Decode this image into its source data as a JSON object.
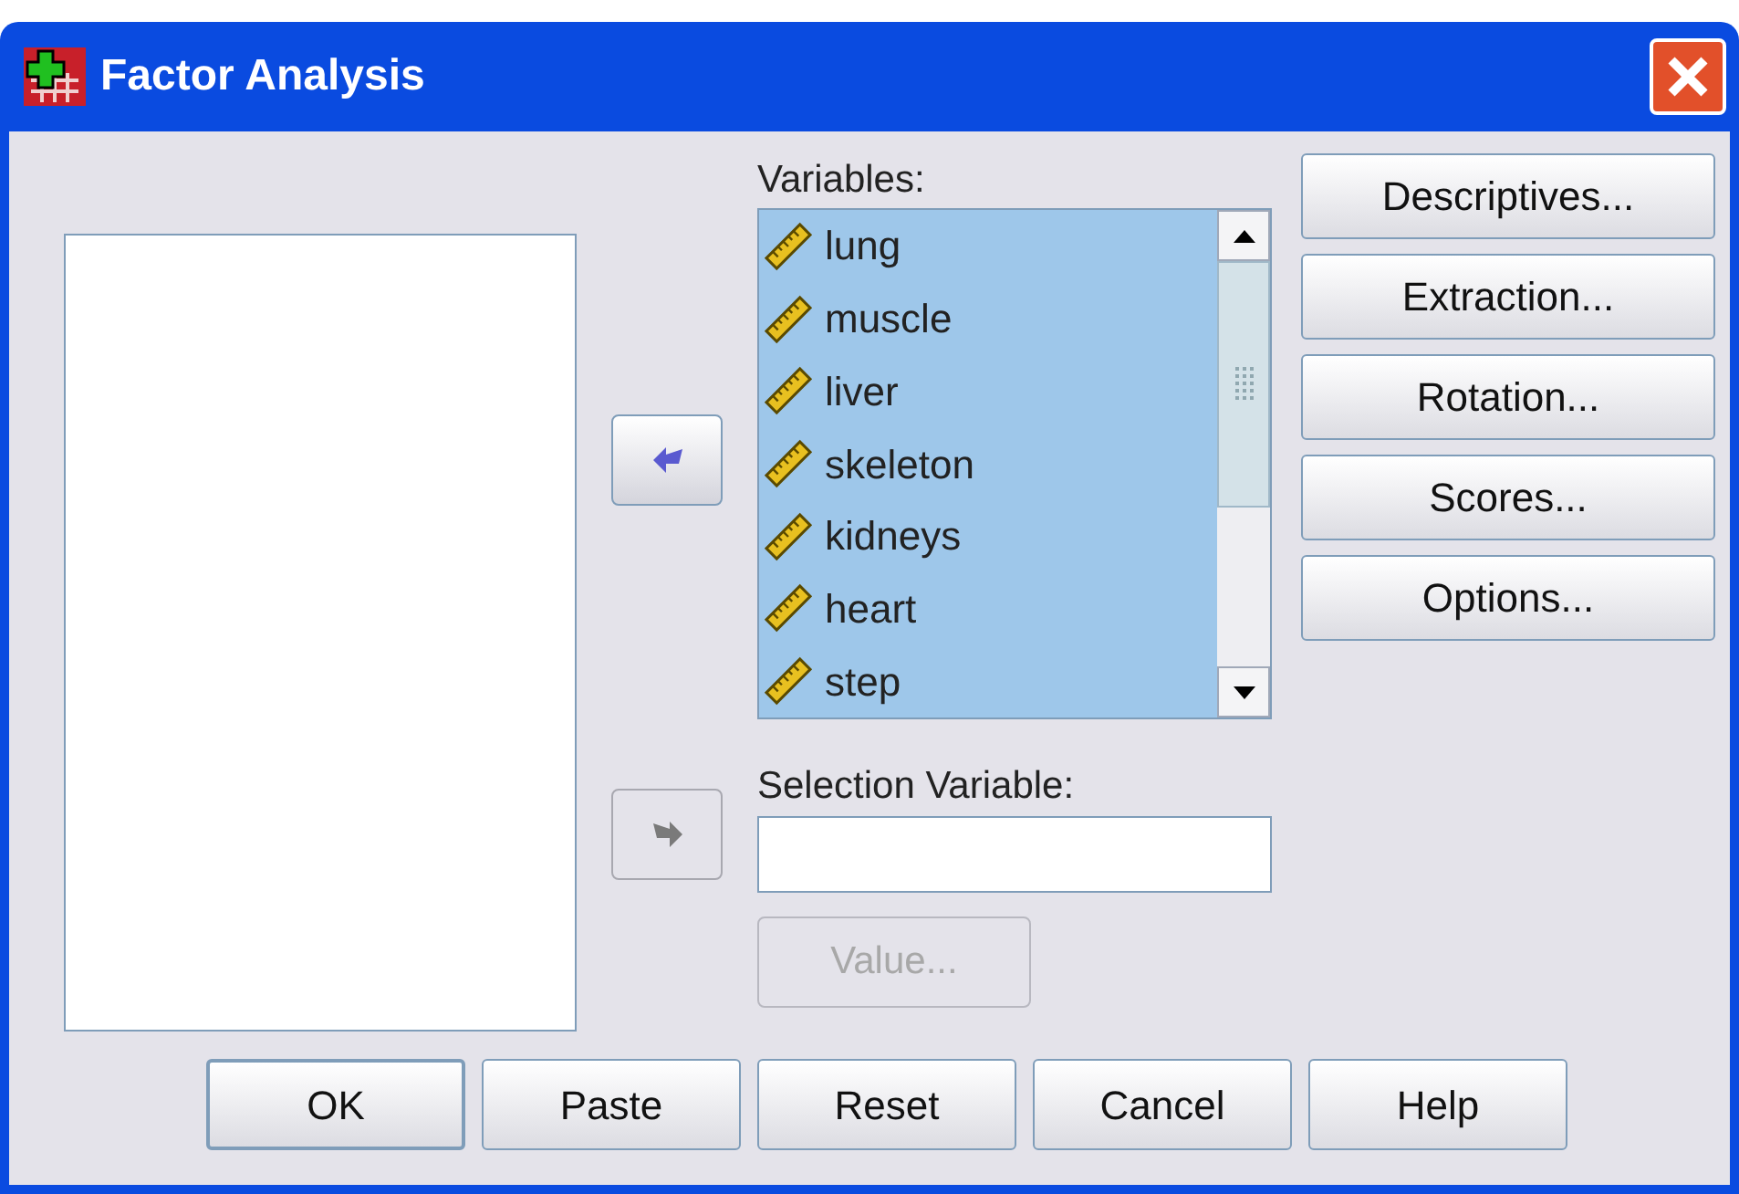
{
  "window": {
    "title": "Factor Analysis"
  },
  "move_buttons": [
    {
      "kind": "left",
      "disabled": false
    },
    {
      "kind": "right",
      "disabled": true
    }
  ],
  "variables": {
    "label": "Variables:",
    "items": [
      {
        "name": "lung",
        "selected": true
      },
      {
        "name": "muscle",
        "selected": true
      },
      {
        "name": "liver",
        "selected": true
      },
      {
        "name": "skeleton",
        "selected": true
      },
      {
        "name": "kidneys",
        "selected": true
      },
      {
        "name": "heart",
        "selected": true
      },
      {
        "name": "step",
        "selected": true
      }
    ]
  },
  "side_buttons": [
    {
      "label": "Descriptives..."
    },
    {
      "label": "Extraction..."
    },
    {
      "label": "Rotation..."
    },
    {
      "label": "Scores..."
    },
    {
      "label": "Options..."
    }
  ],
  "selection_variable": {
    "label": "Selection Variable:",
    "value_button": {
      "label": "Value...",
      "disabled": true
    }
  },
  "buttons": [
    {
      "label": "OK",
      "default": true
    },
    {
      "label": "Paste",
      "default": false
    },
    {
      "label": "Reset",
      "default": false
    },
    {
      "label": "Cancel",
      "default": false
    },
    {
      "label": "Help",
      "default": false
    }
  ]
}
